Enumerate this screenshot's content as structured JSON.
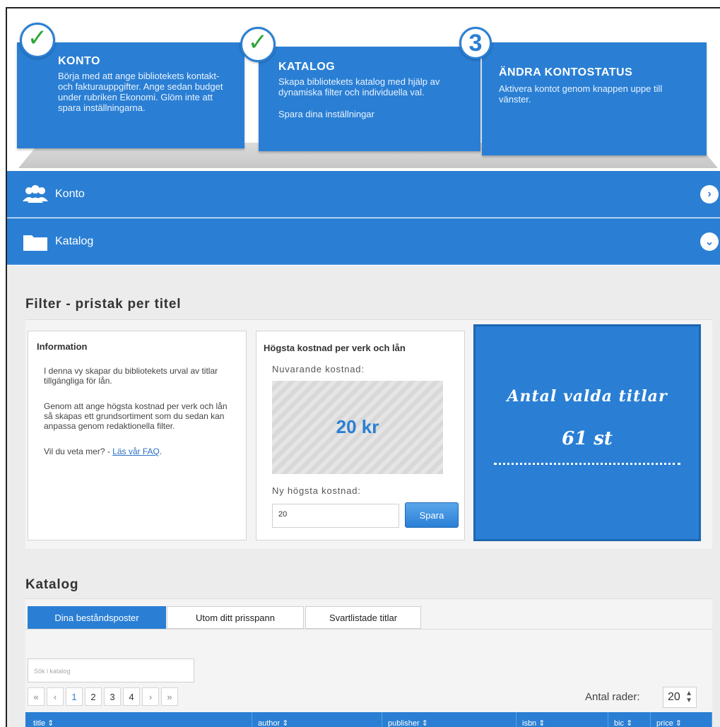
{
  "steps": [
    {
      "title": "KONTO",
      "text": "Börja med att ange bibliotekets kontakt- och fakturauppgifter. Ange sedan budget under rubriken Ekonomi. Glöm inte att spara inställningarna.",
      "badge": "✓"
    },
    {
      "title": "KATALOG",
      "text": "Skapa bibliotekets katalog med hjälp av dynamiska filter och individuella val.",
      "text2": "Spara dina inställningar",
      "badge": "✓"
    },
    {
      "title": "ÄNDRA KONTOSTATUS",
      "text": "Aktivera kontot genom knappen uppe till vänster.",
      "badge": "3"
    }
  ],
  "accordion": {
    "konto": {
      "label": "Konto",
      "icon": "users-icon",
      "chevron": "›"
    },
    "katalog": {
      "label": "Katalog",
      "icon": "folder-icon",
      "chevron": "⌄"
    }
  },
  "filter": {
    "title": "Filter - pristak per titel",
    "info": {
      "heading": "Information",
      "p1": "I denna vy skapar du bibliotekets urval av titlar tillgängliga för lån.",
      "p2": "Genom att ange högsta kostnad per verk och lån så skapas ett grundsortiment som du sedan kan anpassa genom redaktionella filter.",
      "p3_prefix": "Vil du veta mer? - ",
      "faq_link": "Läs vår FAQ",
      "p3_suffix": "."
    },
    "cost": {
      "heading": "Högsta kostnad per verk och lån",
      "current_label": "Nuvarande kostnad:",
      "current_value": "20 kr",
      "new_label": "Ny högsta kostnad:",
      "input_value": "20",
      "save_button": "Spara"
    },
    "result": {
      "line1": "Antal valda titlar",
      "line2": "61 st"
    }
  },
  "katalog": {
    "title": "Katalog",
    "tabs": [
      "Dina beståndsposter",
      "Utom ditt prisspann",
      "Svartlistade titlar"
    ],
    "search_placeholder": "Sök i katalog",
    "pager": {
      "first": "«",
      "prev": "‹",
      "pages": [
        "1",
        "2",
        "3",
        "4"
      ],
      "current": "1",
      "next": "›",
      "last": "»"
    },
    "rows_label": "Antal rader:",
    "rows_value": "20",
    "columns": [
      "title ⇕",
      "author ⇕",
      "publisher ⇕",
      "isbn ⇕",
      "bic ⇕",
      "price ⇕"
    ]
  },
  "colors": {
    "accent": "#2a7fd4",
    "check": "#2ea53a",
    "background": "#ececec"
  }
}
